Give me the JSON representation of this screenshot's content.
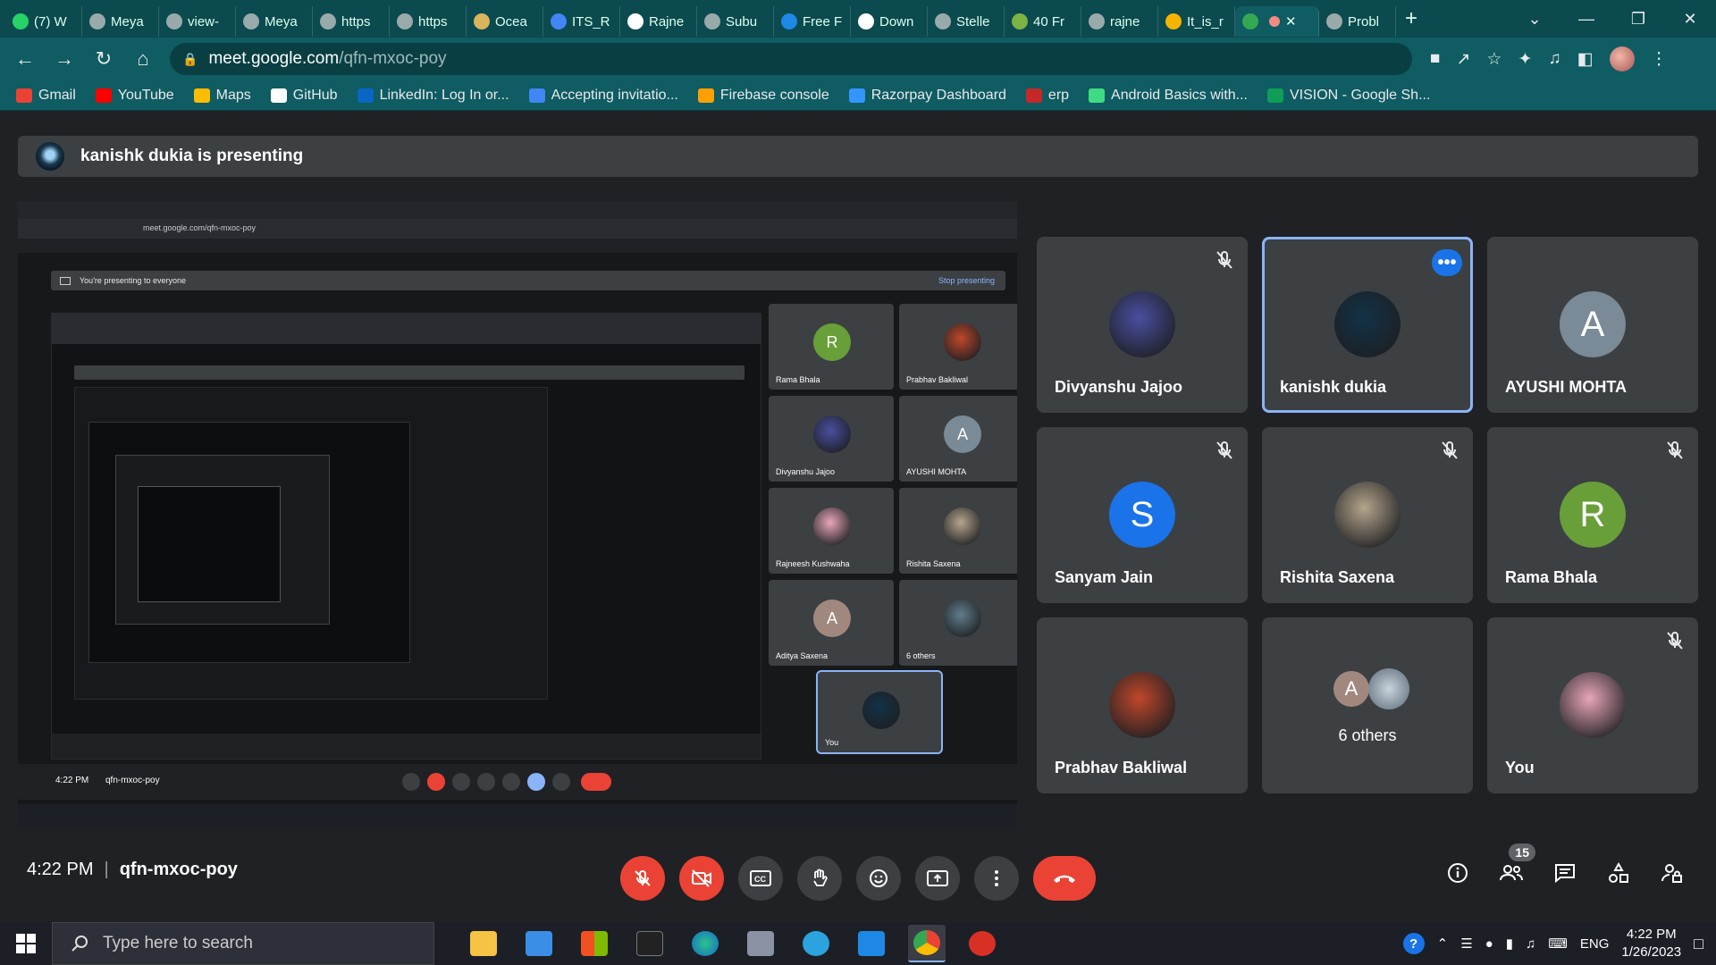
{
  "browser": {
    "tabs": [
      {
        "label": "(7) W",
        "icon": "whatsapp-icon",
        "color": "#25d366"
      },
      {
        "label": "Meya",
        "icon": "page-icon",
        "color": "#9aa"
      },
      {
        "label": "view-",
        "icon": "page-icon",
        "color": "#9aa"
      },
      {
        "label": "Meya",
        "icon": "page-icon",
        "color": "#9aa"
      },
      {
        "label": "https",
        "icon": "page-icon",
        "color": "#9aa"
      },
      {
        "label": "https",
        "icon": "page-icon",
        "color": "#9aa"
      },
      {
        "label": "Ocea",
        "icon": "page-icon",
        "color": "#d9b55c"
      },
      {
        "label": "ITS_R",
        "icon": "doc-icon",
        "color": "#4285f4"
      },
      {
        "label": "Rajne",
        "icon": "github-icon",
        "color": "#ffffff"
      },
      {
        "label": "Subu",
        "icon": "page-icon",
        "color": "#9aa"
      },
      {
        "label": "Free F",
        "icon": "tm-icon",
        "color": "#1e88e5"
      },
      {
        "label": "Down",
        "icon": "page-icon",
        "color": "#ffffff"
      },
      {
        "label": "Stelle",
        "icon": "page-icon",
        "color": "#9aa"
      },
      {
        "label": "40 Fr",
        "icon": "sheet-icon",
        "color": "#7cb342"
      },
      {
        "label": "rajne",
        "icon": "page-icon",
        "color": "#9aa"
      },
      {
        "label": "It_is_r",
        "icon": "chart-icon",
        "color": "#f4b400"
      },
      {
        "label": "",
        "icon": "meet-icon",
        "color": "#34a853",
        "active": true
      },
      {
        "label": "Probl",
        "icon": "page-icon",
        "color": "#9aa"
      }
    ],
    "url_host": "meet.google.com",
    "url_path": "/qfn-mxoc-poy",
    "bookmarks": [
      {
        "label": "Gmail",
        "color": "#ea4335"
      },
      {
        "label": "YouTube",
        "color": "#ff0000"
      },
      {
        "label": "Maps",
        "color": "#fbbc04"
      },
      {
        "label": "GitHub",
        "color": "#ffffff"
      },
      {
        "label": "LinkedIn: Log In or...",
        "color": "#0a66c2"
      },
      {
        "label": "Accepting invitatio...",
        "color": "#4285f4"
      },
      {
        "label": "Firebase console",
        "color": "#ffa000"
      },
      {
        "label": "Razorpay Dashboard",
        "color": "#3395ff"
      },
      {
        "label": "erp",
        "color": "#c62828"
      },
      {
        "label": "Android Basics with...",
        "color": "#3ddc84"
      },
      {
        "label": "VISION - Google Sh...",
        "color": "#0f9d58"
      }
    ]
  },
  "meet": {
    "presenting_banner": "kanishk dukia is presenting",
    "time": "4:22 PM",
    "meeting_code": "qfn-mxoc-poy",
    "participant_count": "15",
    "tiles": [
      {
        "name": "Divyanshu Jajoo",
        "initial": "",
        "avatar_color": "#4a4fa0",
        "muted": true,
        "speaking": false
      },
      {
        "name": "kanishk dukia",
        "initial": "",
        "avatar_color": "#123248",
        "muted": false,
        "speaking": true
      },
      {
        "name": "AYUSHI MOHTA",
        "initial": "A",
        "avatar_color": "#7a8a96",
        "muted": false,
        "speaking": false
      },
      {
        "name": "Sanyam Jain",
        "initial": "S",
        "avatar_color": "#1a73e8",
        "muted": true,
        "speaking": false
      },
      {
        "name": "Rishita Saxena",
        "initial": "",
        "avatar_color": "#b5a58c",
        "muted": true,
        "speaking": false
      },
      {
        "name": "Rama Bhala",
        "initial": "R",
        "avatar_color": "#689f38",
        "muted": true,
        "speaking": false
      },
      {
        "name": "Prabhav Bakliwal",
        "initial": "",
        "avatar_color": "#c0472a",
        "muted": false,
        "speaking": false
      },
      {
        "name": "6 others",
        "initial": "A",
        "avatar_color": "#a1887f",
        "muted": false,
        "speaking": false
      },
      {
        "name": "You",
        "initial": "",
        "avatar_color": "#e9a6b8",
        "muted": true,
        "speaking": false
      }
    ]
  },
  "shared_screen": {
    "banner": "You're presenting to everyone",
    "stop_label": "Stop presenting",
    "url": "meet.google.com/qfn-mxoc-poy",
    "time": "4:22 PM",
    "code": "qfn-mxoc-poy",
    "tiles": [
      {
        "name": "Rama Bhala",
        "initial": "R",
        "color": "#689f38"
      },
      {
        "name": "Prabhav Bakliwal",
        "initial": "",
        "color": "#c0472a"
      },
      {
        "name": "Divyanshu Jajoo",
        "initial": "",
        "color": "#4a4fa0"
      },
      {
        "name": "AYUSHI MOHTA",
        "initial": "A",
        "color": "#7a8a96"
      },
      {
        "name": "Rajneesh Kushwaha",
        "initial": "",
        "color": "#e9a6b8"
      },
      {
        "name": "Rishita Saxena",
        "initial": "",
        "color": "#b5a58c"
      },
      {
        "name": "Aditya Saxena",
        "initial": "A",
        "color": "#a1887f"
      },
      {
        "name": "6 others",
        "initial": "",
        "color": "#607d8b"
      },
      {
        "name": "",
        "initial": "",
        "color": "#3c4043"
      },
      {
        "name": "You",
        "initial": "",
        "color": "#123248"
      }
    ]
  },
  "taskbar": {
    "search_placeholder": "Type here to search",
    "lang": "ENG",
    "time": "4:22 PM",
    "date": "1/26/2023"
  }
}
